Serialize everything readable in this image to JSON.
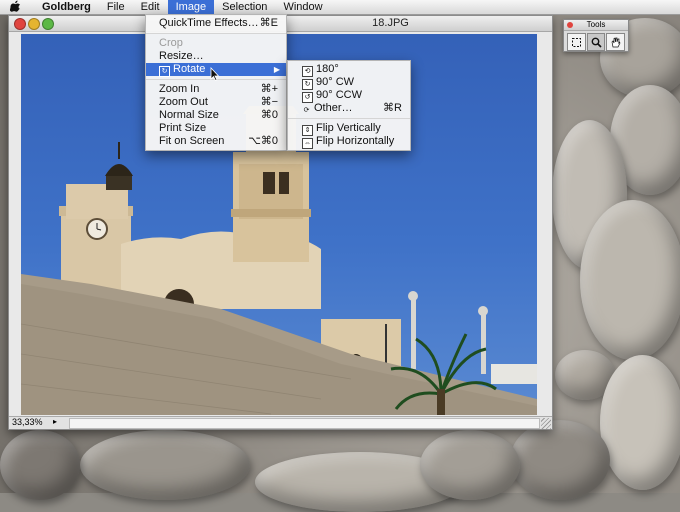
{
  "menubar": {
    "apple": "",
    "items": [
      {
        "label": "Goldberg"
      },
      {
        "label": "File"
      },
      {
        "label": "Edit"
      },
      {
        "label": "Image"
      },
      {
        "label": "Selection"
      },
      {
        "label": "Window"
      }
    ]
  },
  "window": {
    "title_suffix": "18.JPG",
    "zoom": "33,33%"
  },
  "tools": {
    "title": "Tools"
  },
  "image_menu": {
    "quicktime": {
      "label": "QuickTime Effects…",
      "shortcut": "⌘E"
    },
    "crop": {
      "label": "Crop"
    },
    "resize": {
      "label": "Resize…"
    },
    "rotate": {
      "label": "Rotate"
    },
    "zoom_in": {
      "label": "Zoom In",
      "shortcut": "⌘+"
    },
    "zoom_out": {
      "label": "Zoom Out",
      "shortcut": "⌘−"
    },
    "normal_size": {
      "label": "Normal Size",
      "shortcut": "⌘0"
    },
    "print_size": {
      "label": "Print Size"
    },
    "fit_on_screen": {
      "label": "Fit on Screen",
      "shortcut": "⌥⌘0"
    }
  },
  "rotate_menu": {
    "r180": {
      "label": "180°"
    },
    "r90cw": {
      "label": "90° CW"
    },
    "r90ccw": {
      "label": "90° CCW"
    },
    "other": {
      "label": "Other…",
      "shortcut": "⌘R"
    },
    "flip_v": {
      "label": "Flip Vertically"
    },
    "flip_h": {
      "label": "Flip Horizontally"
    }
  },
  "colors": {
    "highlight": "#3b6fd6",
    "sky": "#3461b8"
  }
}
